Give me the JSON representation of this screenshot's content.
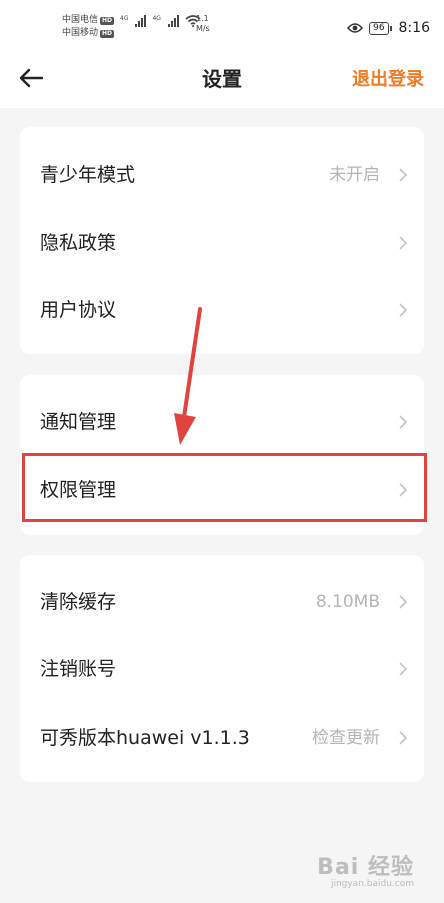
{
  "status_bar": {
    "carrier1": "中国电信",
    "carrier2": "中国移动",
    "hd": "HD",
    "signal_tag": "4G",
    "speed_value": "1.1",
    "speed_unit": "M/s",
    "battery": "96",
    "time": "8:16"
  },
  "header": {
    "title": "设置",
    "logout_label": "退出登录"
  },
  "groups": [
    {
      "items": [
        {
          "label": "青少年模式",
          "value": "未开启"
        },
        {
          "label": "隐私政策"
        },
        {
          "label": "用户协议"
        }
      ]
    },
    {
      "items": [
        {
          "label": "通知管理"
        },
        {
          "label": "权限管理"
        }
      ]
    },
    {
      "items": [
        {
          "label": "清除缓存",
          "value": "8.10MB"
        },
        {
          "label": "注销账号"
        },
        {
          "label": "可秀版本huawei v1.1.3",
          "value": "检查更新"
        }
      ]
    }
  ],
  "watermark": {
    "main": "Bai 经验",
    "sub": "jingyan.baidu.com"
  },
  "colors": {
    "accent": "#f47a24",
    "highlight": "#e0443e"
  }
}
